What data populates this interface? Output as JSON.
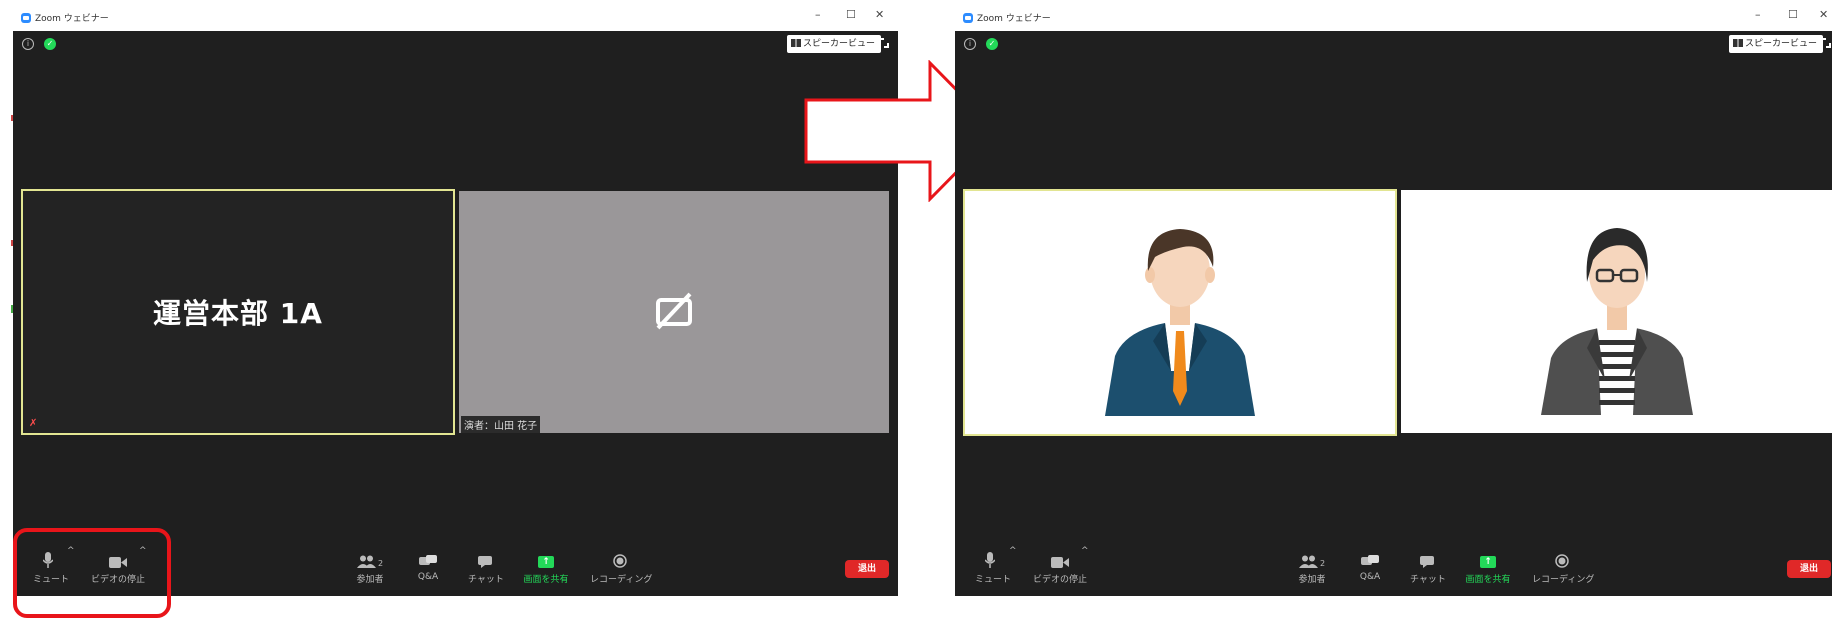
{
  "window_title": "Zoom ウェビナー",
  "speaker_view_label": "スピーカービュー",
  "left": {
    "tile1_name": "運営本部 1A",
    "tile2_label": "演者：山田 花子"
  },
  "toolbar": {
    "mute": "ミュート",
    "video_stop": "ビデオの停止",
    "participants": "参加者",
    "participants_count": "2",
    "qa": "Q&A",
    "chat": "チャット",
    "share": "画面を共有",
    "recording": "レコーディング",
    "leave": "退出"
  },
  "colors": {
    "window_bg": "#1f1f1f",
    "active_border": "#e2e592",
    "share_green": "#23d959",
    "leave_red": "#e02828",
    "highlight_red": "#e8151a"
  }
}
